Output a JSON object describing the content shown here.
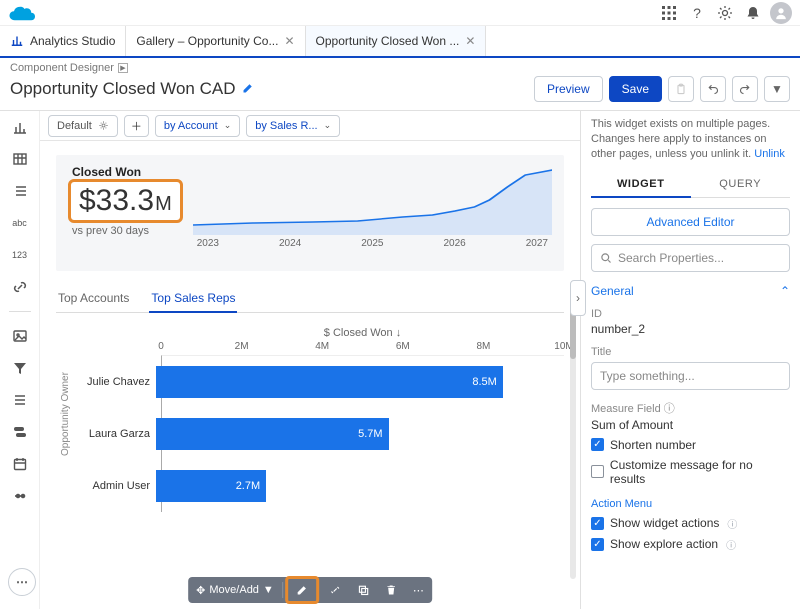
{
  "header": {
    "app_name": "Analytics Studio"
  },
  "tabs": [
    {
      "label": "Gallery – Opportunity Co...",
      "closable": true,
      "active": false
    },
    {
      "label": "Opportunity Closed Won ...",
      "closable": true,
      "active": true
    }
  ],
  "breadcrumb": "Component Designer",
  "page_title": "Opportunity Closed Won CAD",
  "actions": {
    "preview": "Preview",
    "save": "Save"
  },
  "variants": {
    "default": "Default",
    "filters": [
      "by Account",
      "by Sales R..."
    ]
  },
  "metric": {
    "label": "Closed Won",
    "value": "$33.3",
    "unit": "M",
    "sub": "vs prev 30 days"
  },
  "spark_years": [
    "2023",
    "2024",
    "2025",
    "2026",
    "2027"
  ],
  "chart_tabs": [
    "Top Accounts",
    "Top Sales Reps"
  ],
  "chart_tab_active": 1,
  "chart_data": {
    "type": "bar",
    "orientation": "horizontal",
    "title": "$ Closed Won ↓",
    "ylabel": "Opportunity Owner",
    "xlim": [
      0,
      10
    ],
    "xticks": [
      "0",
      "2M",
      "4M",
      "6M",
      "8M",
      "10M"
    ],
    "categories": [
      "Julie Chavez",
      "Laura Garza",
      "Admin User"
    ],
    "values": [
      8.5,
      5.7,
      2.7
    ],
    "value_labels": [
      "8.5M",
      "5.7M",
      "2.7M"
    ],
    "unit": "M"
  },
  "footer": {
    "move_add": "Move/Add"
  },
  "right": {
    "info": "This widget exists on multiple pages. Changes here apply to instances on other pages, unless you unlink it.",
    "unlink": "Unlink",
    "tabs": [
      "WIDGET",
      "QUERY"
    ],
    "advanced": "Advanced Editor",
    "search_placeholder": "Search Properties...",
    "section": "General",
    "id_label": "ID",
    "id_value": "number_2",
    "title_label": "Title",
    "title_placeholder": "Type something...",
    "measure_label": "Measure Field",
    "measure_value": "Sum of Amount",
    "checks": {
      "shorten": "Shorten number",
      "customize": "Customize message for no results"
    },
    "action_menu_label": "Action Menu",
    "actions": {
      "show_widget": "Show widget actions",
      "show_explore": "Show explore action"
    }
  }
}
